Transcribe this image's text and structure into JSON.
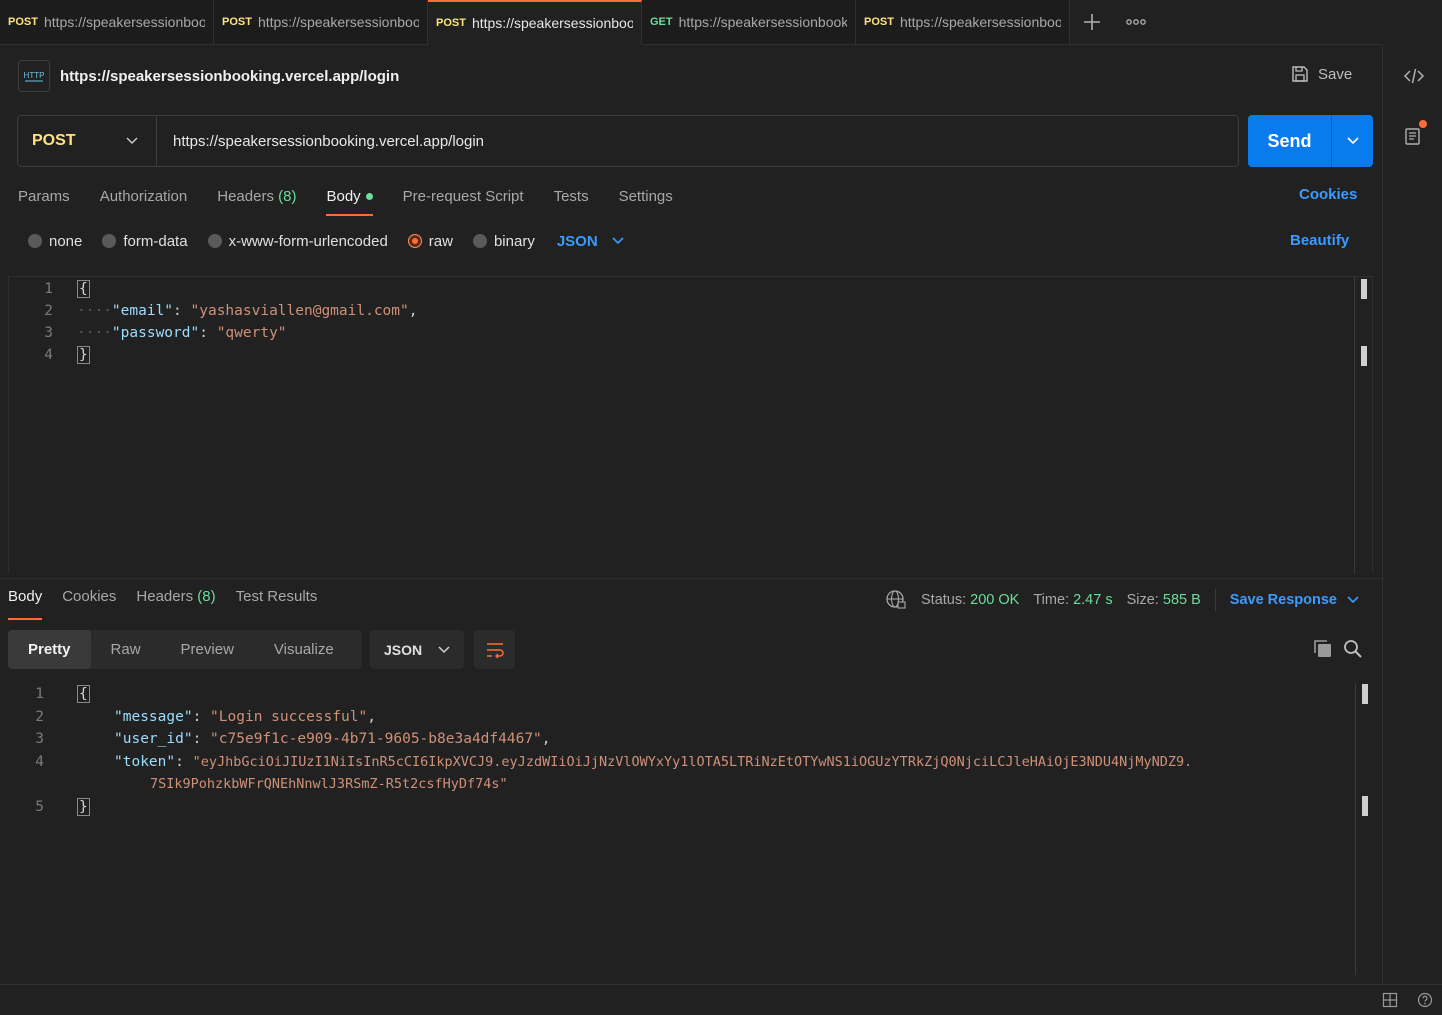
{
  "tabs": [
    {
      "method": "POST",
      "url": "https://speakersessionbooking.vercel.app/login",
      "active": false
    },
    {
      "method": "POST",
      "url": "https://speakersessionbooking.vercel.app/login",
      "active": false
    },
    {
      "method": "POST",
      "url": "https://speakersessionbooking.vercel.app/login",
      "active": true
    },
    {
      "method": "GET",
      "url": "https://speakersessionbooking.vercel.app/",
      "active": false
    },
    {
      "method": "POST",
      "url": "https://speakersessionbooking.vercel.app/login",
      "active": false
    }
  ],
  "request": {
    "badge": "HTTP",
    "name": "https://speakersessionbooking.vercel.app/login",
    "save_label": "Save",
    "method": "POST",
    "url": "https://speakersessionbooking.vercel.app/login",
    "send_label": "Send"
  },
  "request_tabs": {
    "params": "Params",
    "authorization": "Authorization",
    "headers": "Headers",
    "headers_count": "(8)",
    "body": "Body",
    "prerequest": "Pre-request Script",
    "tests": "Tests",
    "settings": "Settings",
    "cookies": "Cookies"
  },
  "body_types": {
    "none": "none",
    "form_data": "form-data",
    "urlencoded": "x-www-form-urlencoded",
    "raw": "raw",
    "binary": "binary",
    "format": "JSON",
    "beautify": "Beautify"
  },
  "request_body": {
    "line_numbers": [
      "1",
      "2",
      "3",
      "4"
    ],
    "open_brace": "{",
    "close_brace": "}",
    "indent": "····",
    "email_key": "\"email\"",
    "email_value": "\"yashasviallen@gmail.com\"",
    "password_key": "\"password\"",
    "password_value": "\"qwerty\""
  },
  "response_tabs": {
    "body": "Body",
    "cookies": "Cookies",
    "headers": "Headers",
    "headers_count": "(8)",
    "test_results": "Test Results"
  },
  "response_status": {
    "status_label": "Status:",
    "status_value": "200 OK",
    "time_label": "Time:",
    "time_value": "2.47 s",
    "size_label": "Size:",
    "size_value": "585 B",
    "save_response": "Save Response"
  },
  "response_view": {
    "pretty": "Pretty",
    "raw": "Raw",
    "preview": "Preview",
    "visualize": "Visualize",
    "format": "JSON"
  },
  "response_body": {
    "line_numbers": [
      "1",
      "2",
      "3",
      "4",
      "5"
    ],
    "open_brace": "{",
    "close_brace": "}",
    "message_key": "\"message\"",
    "message_value": "\"Login successful\"",
    "user_id_key": "\"user_id\"",
    "user_id_value": "\"c75e9f1c-e909-4b71-9605-b8e3a4df4467\"",
    "token_key": "\"token\"",
    "token_value_line1": "\"eyJhbGciOiJIUzI1NiIsInR5cCI6IkpXVCJ9.eyJzdWIiOiJjNzVlOWYxYy1lOTA5LTRiNzEtOTYwNS1iOGUzYTRkZjQ0NjciLCJleHAiOjE3NDU4NjMyNDZ9.",
    "token_value_line2": "7SIk9PohzkbWFrQNEhNnwlJ3RSmZ-R5t2csfHyDf74s\""
  },
  "colors": {
    "accent": "#ff6c37",
    "send": "#097bed",
    "post": "#ffe47e",
    "get": "#6bdd9a",
    "link": "#3b9bff"
  }
}
